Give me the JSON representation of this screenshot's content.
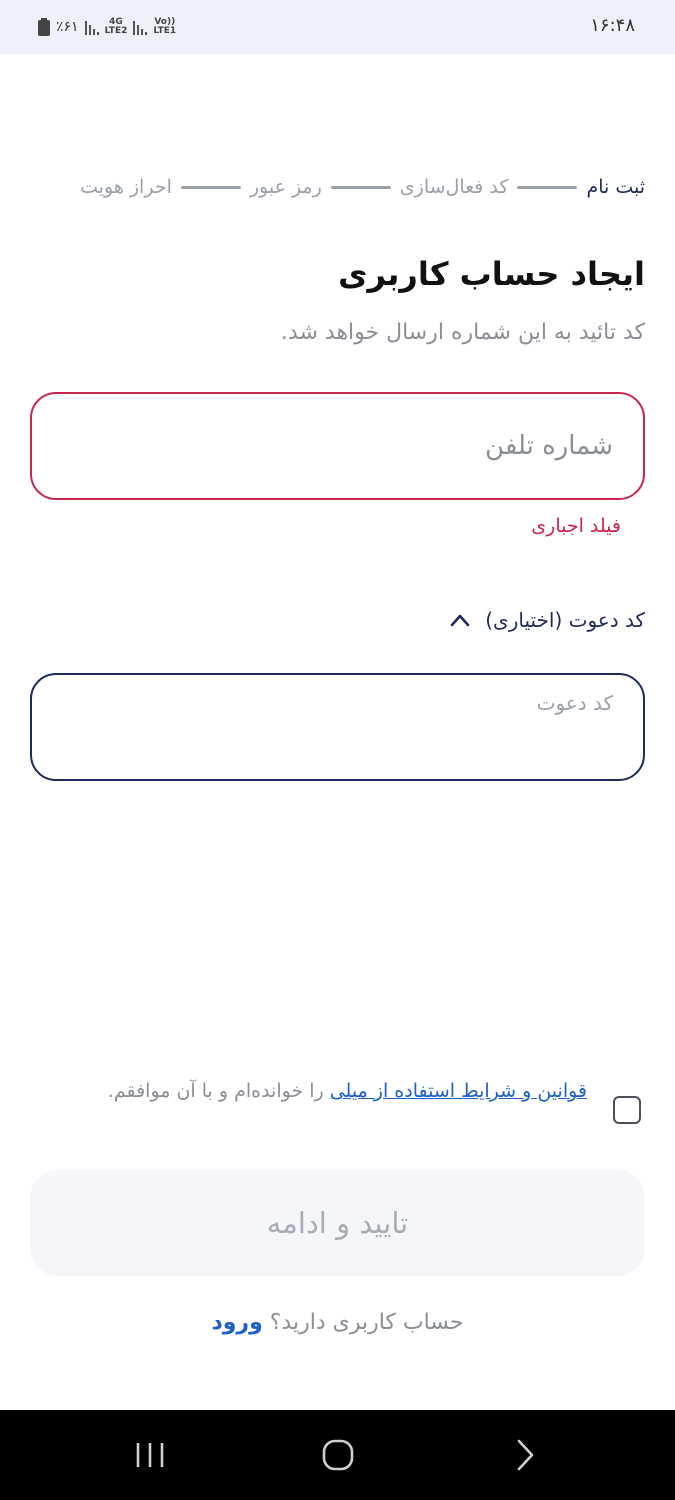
{
  "status_bar": {
    "time": "۱۶:۴۸",
    "battery": "٪۶۱",
    "network_1": "4G",
    "network_1_sub": "LTE2",
    "network_2": "Vo))",
    "network_2_sub": "LTE1"
  },
  "stepper": {
    "steps": [
      "ثبت نام",
      "کد فعال‌سازی",
      "رمز عبور",
      "احراز هویت"
    ],
    "active_index": 0
  },
  "header": {
    "title": "ایجاد حساب کاربری",
    "subtitle": "کد تائید به این شماره ارسال خواهد شد."
  },
  "phone_field": {
    "placeholder": "شماره تلفن",
    "value": "",
    "error": "فیلد اجباری",
    "error_color": "#c8264f"
  },
  "invite": {
    "toggle_label": "کد دعوت (اختیاری)",
    "placeholder": "کد دعوت",
    "value": ""
  },
  "terms": {
    "checked": false,
    "link_text": "قوانین و شرایط استفاده از میلی",
    "rest_text": " را خوانده‌ام و با آن موافقم."
  },
  "continue_button": {
    "label": "تایید و ادامه",
    "enabled": false
  },
  "login": {
    "prompt": "حساب کاربری دارید؟ ",
    "link": "ورود"
  },
  "colors": {
    "primary": "#1e2a5a",
    "link": "#1e5fc8",
    "error": "#c8264f"
  }
}
